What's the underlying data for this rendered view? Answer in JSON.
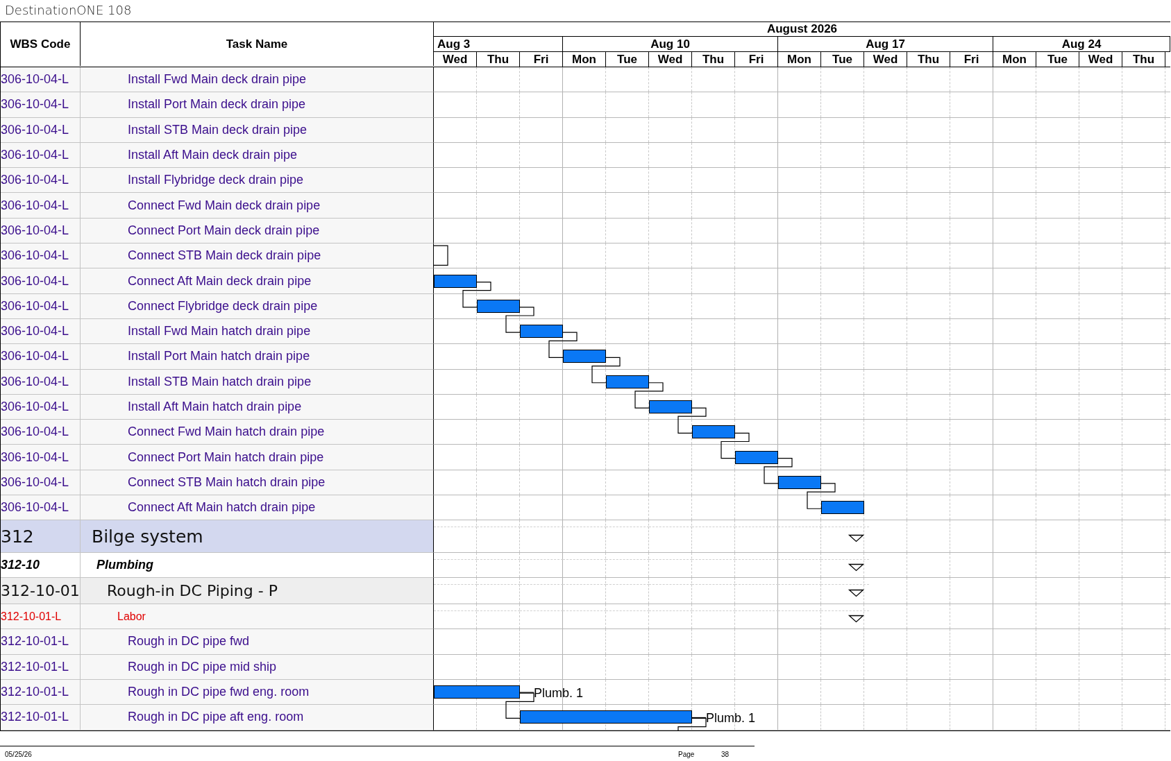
{
  "document_title": "DestinationONE 108",
  "columns": {
    "wbs": "WBS Code",
    "task": "Task Name"
  },
  "timescale": {
    "month": "August 2026",
    "weeks": [
      {
        "label": "Aug 3",
        "days": [
          "Wed",
          "Thu",
          "Fri"
        ]
      },
      {
        "label": "Aug 10",
        "days": [
          "Mon",
          "Tue",
          "Wed",
          "Thu",
          "Fri"
        ]
      },
      {
        "label": "Aug 17",
        "days": [
          "Mon",
          "Tue",
          "Wed",
          "Thu",
          "Fri"
        ]
      },
      {
        "label": "Aug 24",
        "days": [
          "Mon",
          "Tue",
          "Wed",
          "Thu"
        ]
      }
    ]
  },
  "rows": [
    {
      "kind": "task",
      "wbs": "306-10-04-L",
      "name": "Install Fwd Main deck drain pipe"
    },
    {
      "kind": "task",
      "wbs": "306-10-04-L",
      "name": "Install Port Main deck drain pipe"
    },
    {
      "kind": "task",
      "wbs": "306-10-04-L",
      "name": "Install STB Main deck drain pipe"
    },
    {
      "kind": "task",
      "wbs": "306-10-04-L",
      "name": "Install Aft Main deck drain pipe"
    },
    {
      "kind": "task",
      "wbs": "306-10-04-L",
      "name": "Install Flybridge deck drain pipe"
    },
    {
      "kind": "task",
      "wbs": "306-10-04-L",
      "name": "Connect Fwd Main deck drain pipe"
    },
    {
      "kind": "task",
      "wbs": "306-10-04-L",
      "name": "Connect Port Main deck drain pipe"
    },
    {
      "kind": "task",
      "wbs": "306-10-04-L",
      "name": "Connect STB Main deck drain pipe",
      "bar": {
        "linked": true,
        "days": [
          false,
          false,
          false,
          false,
          false,
          false,
          false,
          false,
          false,
          false,
          false,
          false,
          false,
          false,
          false,
          false,
          false
        ]
      }
    },
    {
      "kind": "task",
      "wbs": "306-10-04-L",
      "name": "Connect Aft Main deck drain pipe",
      "bar": {
        "linked": true,
        "days": [
          true,
          false,
          false,
          false,
          false,
          false,
          false,
          false,
          false,
          false,
          false,
          false,
          false,
          false,
          false,
          false,
          false
        ]
      }
    },
    {
      "kind": "task",
      "wbs": "306-10-04-L",
      "name": "Connect Flybridge deck drain pipe",
      "bar": {
        "linked": true,
        "days": [
          false,
          true,
          false,
          false,
          false,
          false,
          false,
          false,
          false,
          false,
          false,
          false,
          false,
          false,
          false,
          false,
          false
        ]
      }
    },
    {
      "kind": "task",
      "wbs": "306-10-04-L",
      "name": "Install Fwd Main hatch drain pipe",
      "bar": {
        "linked": true,
        "days": [
          false,
          false,
          true,
          false,
          false,
          false,
          false,
          false,
          false,
          false,
          false,
          false,
          false,
          false,
          false,
          false,
          false
        ]
      }
    },
    {
      "kind": "task",
      "wbs": "306-10-04-L",
      "name": "Install Port Main hatch drain pipe",
      "bar": {
        "linked": true,
        "days": [
          false,
          false,
          false,
          true,
          false,
          false,
          false,
          false,
          false,
          false,
          false,
          false,
          false,
          false,
          false,
          false,
          false
        ]
      }
    },
    {
      "kind": "task",
      "wbs": "306-10-04-L",
      "name": "Install STB Main hatch drain pipe",
      "bar": {
        "linked": true,
        "days": [
          false,
          false,
          false,
          false,
          true,
          false,
          false,
          false,
          false,
          false,
          false,
          false,
          false,
          false,
          false,
          false,
          false
        ]
      }
    },
    {
      "kind": "task",
      "wbs": "306-10-04-L",
      "name": "Install Aft Main hatch drain pipe",
      "bar": {
        "linked": true,
        "days": [
          false,
          false,
          false,
          false,
          false,
          true,
          false,
          false,
          false,
          false,
          false,
          false,
          false,
          false,
          false,
          false,
          false
        ]
      }
    },
    {
      "kind": "task",
      "wbs": "306-10-04-L",
      "name": "Connect Fwd Main hatch drain pipe",
      "bar": {
        "linked": true,
        "days": [
          false,
          false,
          false,
          false,
          false,
          false,
          true,
          false,
          false,
          false,
          false,
          false,
          false,
          false,
          false,
          false,
          false
        ]
      }
    },
    {
      "kind": "task",
      "wbs": "306-10-04-L",
      "name": "Connect Port Main hatch drain pipe",
      "bar": {
        "linked": true,
        "days": [
          false,
          false,
          false,
          false,
          false,
          false,
          false,
          true,
          false,
          false,
          false,
          false,
          false,
          false,
          false,
          false,
          false
        ]
      }
    },
    {
      "kind": "task",
      "wbs": "306-10-04-L",
      "name": "Connect STB Main hatch drain pipe",
      "bar": {
        "linked": true,
        "days": [
          false,
          false,
          false,
          false,
          false,
          false,
          false,
          false,
          true,
          false,
          false,
          false,
          false,
          false,
          false,
          false,
          false
        ]
      }
    },
    {
      "kind": "task",
      "wbs": "306-10-04-L",
      "name": "Connect Aft Main hatch drain pipe",
      "bar": {
        "linked": false,
        "days": [
          false,
          false,
          false,
          false,
          false,
          false,
          false,
          false,
          false,
          true,
          false,
          false,
          false,
          false,
          false,
          false,
          false
        ]
      }
    },
    {
      "kind": "level1",
      "wbs": "312",
      "name": "Bilge system",
      "summary": {
        "days": [
          true,
          true,
          true,
          true,
          true,
          true,
          true,
          true,
          true,
          true,
          false,
          false,
          false,
          false,
          false,
          false,
          false
        ]
      }
    },
    {
      "kind": "level2",
      "wbs": "312-10",
      "name": "Plumbing",
      "summary": {
        "days": [
          true,
          true,
          true,
          true,
          true,
          true,
          true,
          true,
          true,
          true,
          false,
          false,
          false,
          false,
          false,
          false,
          false
        ]
      }
    },
    {
      "kind": "level3",
      "wbs": "312-10-01",
      "name": "Rough-in DC Piping - P",
      "summary": {
        "days": [
          true,
          true,
          true,
          true,
          true,
          true,
          true,
          true,
          true,
          true,
          false,
          false,
          false,
          false,
          false,
          false,
          false
        ]
      }
    },
    {
      "kind": "labor",
      "wbs": "312-10-01-L",
      "name": "Labor",
      "summary": {
        "days": [
          true,
          true,
          true,
          true,
          true,
          true,
          true,
          true,
          true,
          true,
          false,
          false,
          false,
          false,
          false,
          false,
          false
        ]
      }
    },
    {
      "kind": "task",
      "wbs": "312-10-01-L",
      "name": "Rough in DC pipe fwd"
    },
    {
      "kind": "task",
      "wbs": "312-10-01-L",
      "name": "Rough in DC pipe mid ship"
    },
    {
      "kind": "task",
      "wbs": "312-10-01-L",
      "name": "Rough in DC pipe fwd eng. room",
      "bar": {
        "linked": true,
        "resource": "Plumb. 1",
        "days": [
          true,
          true,
          false,
          false,
          false,
          false,
          false,
          false,
          false,
          false,
          false,
          false,
          false,
          false,
          false,
          false,
          false
        ]
      }
    },
    {
      "kind": "task",
      "wbs": "312-10-01-L",
      "name": "Rough in DC pipe aft eng. room",
      "bar": {
        "linked": true,
        "resource": "Plumb. 1",
        "days": [
          false,
          false,
          true,
          true,
          true,
          true,
          false,
          false,
          false,
          false,
          false,
          false,
          false,
          false,
          false,
          false,
          false
        ]
      }
    }
  ],
  "footer": {
    "date": "05/25/26",
    "page_label": "Page",
    "page_number": "38"
  }
}
